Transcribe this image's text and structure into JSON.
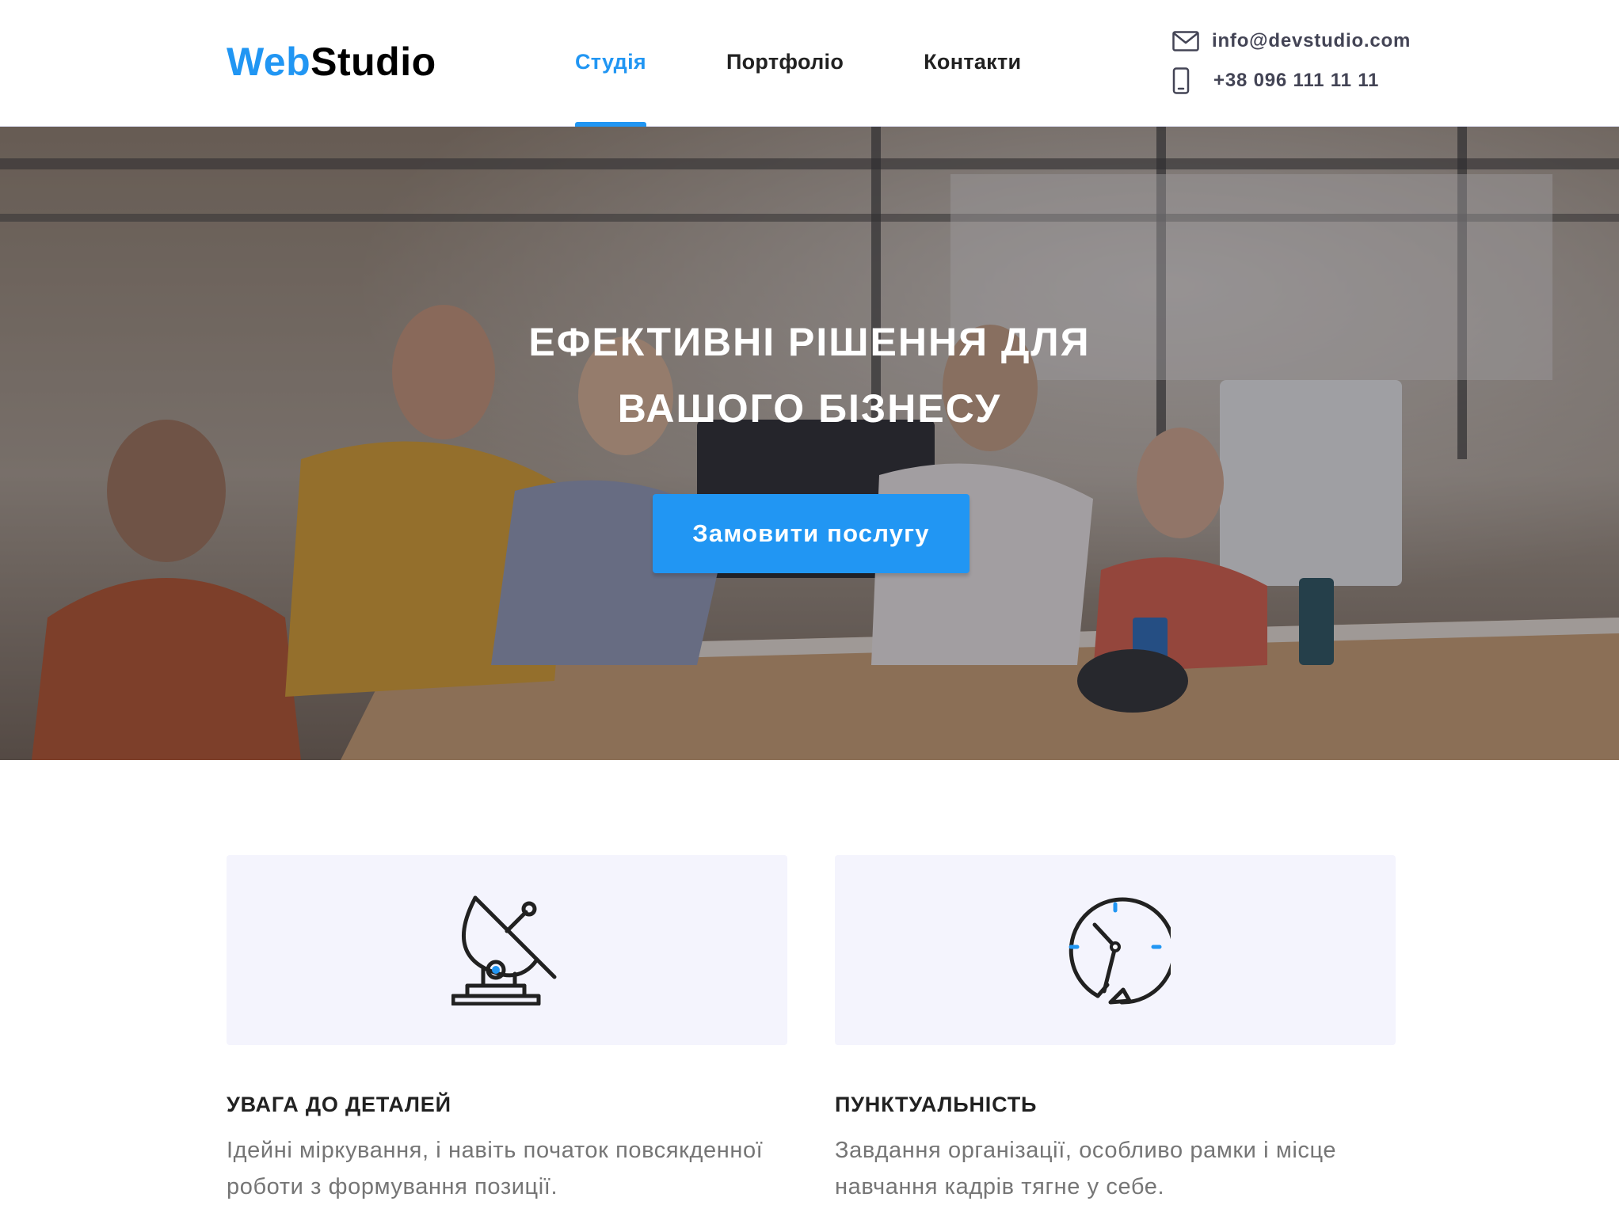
{
  "header": {
    "logo": {
      "accent": "Web",
      "main": "Studio"
    },
    "nav": [
      {
        "label": "Студія",
        "active": true
      },
      {
        "label": "Портфоліо",
        "active": false
      },
      {
        "label": "Контакти",
        "active": false
      }
    ],
    "contacts": {
      "email": "info@devstudio.com",
      "phone": "+38 096 111 11 11",
      "email_icon": "envelope-icon",
      "phone_icon": "smartphone-icon"
    }
  },
  "hero": {
    "title": "Ефективні рішення для вашого бізнесу",
    "button_label": "Замовити послугу"
  },
  "features": [
    {
      "icon": "satellite-dish-icon",
      "title": "Увага до деталей",
      "text": "Ідейні міркування, і навіть початок повсякденної роботи з формування позиції."
    },
    {
      "icon": "clock-icon",
      "title": "Пунктуальність",
      "text": "Завдання організації, особливо рамки і місце навчання кадрів тягне у себе."
    }
  ],
  "colors": {
    "accent": "#2196f3",
    "text_dark": "#212121",
    "text_muted": "#757575",
    "card_bg": "#f4f4fd",
    "contact_text": "#434455"
  }
}
